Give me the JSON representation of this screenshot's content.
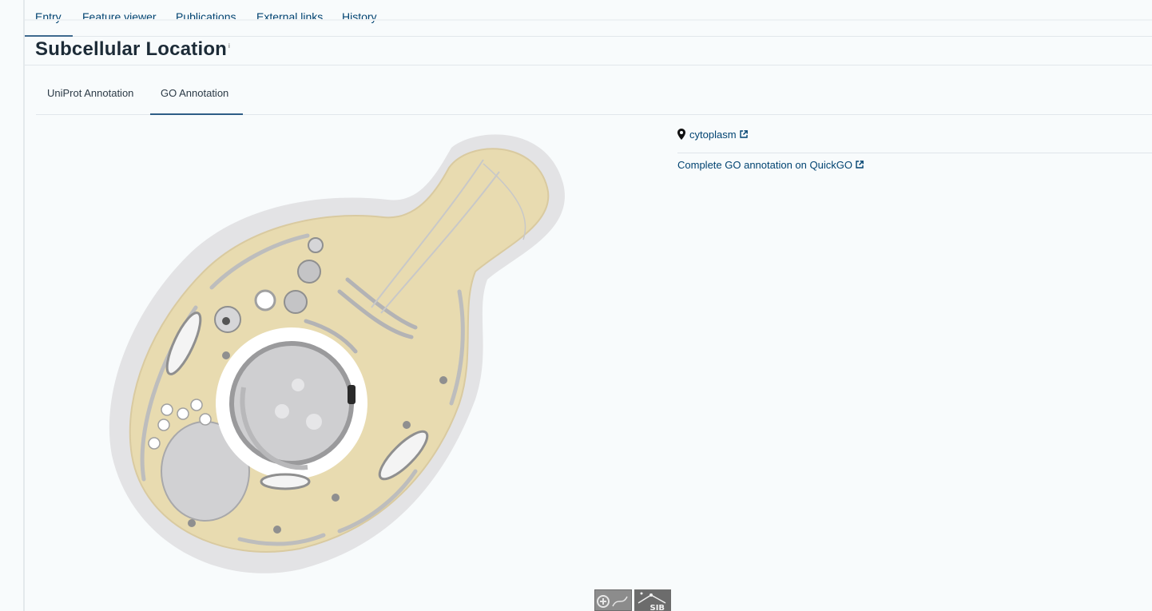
{
  "nav": {
    "items": [
      "Entry",
      "Feature viewer",
      "Publications",
      "External links",
      "History"
    ],
    "active": "Entry"
  },
  "section": {
    "title": "Subcellular Location",
    "info_marker": "i"
  },
  "tabs": {
    "items": [
      "UniProt Annotation",
      "GO Annotation"
    ],
    "active": "GO Annotation"
  },
  "locations": {
    "items": [
      {
        "label": "cytoplasm",
        "icon": "location-pin-icon"
      }
    ],
    "quickgo_label": "Complete GO annotation on QuickGO"
  },
  "footer_logos": {
    "items": [
      "swissbiopics-logo",
      "sib-logo"
    ],
    "sib_text": "SIB"
  },
  "colors": {
    "link": "#014371",
    "cytoplasm_fill": "#e8dbb0",
    "cell_halo": "#e3e3e5",
    "tab_active": "#2e5d86"
  }
}
